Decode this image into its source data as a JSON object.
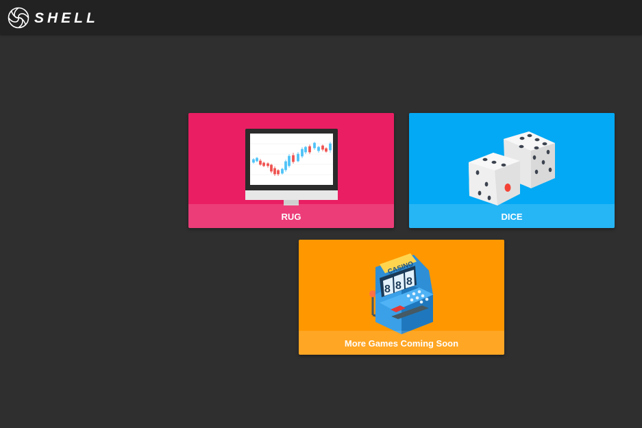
{
  "header": {
    "logo_text": "SHELL",
    "logo_icon": "shell-swirl-icon"
  },
  "games": [
    {
      "label": "RUG",
      "icon": "trading-chart-monitor-icon",
      "color": "#e91e63"
    },
    {
      "label": "DICE",
      "icon": "dice-pair-icon",
      "color": "#03a9f4"
    },
    {
      "label": "More Games Coming Soon",
      "icon": "casino-slot-machine-icon",
      "color": "#ff9800"
    }
  ]
}
